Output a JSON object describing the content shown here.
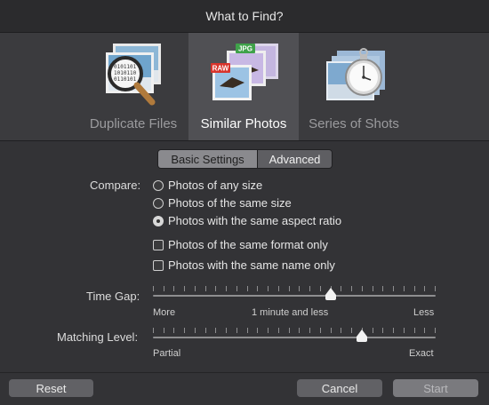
{
  "window": {
    "title": "What to Find?"
  },
  "modes": [
    {
      "label": "Duplicate Files",
      "active": false
    },
    {
      "label": "Similar Photos",
      "active": true
    },
    {
      "label": "Series of Shots",
      "active": false
    }
  ],
  "badges": {
    "jpg": "JPG",
    "raw": "RAW"
  },
  "settings_tabs": [
    {
      "label": "Basic Settings",
      "selected": false
    },
    {
      "label": "Advanced",
      "selected": true
    }
  ],
  "compare": {
    "label": "Compare:",
    "options": [
      {
        "label": "Photos of any size",
        "selected": false
      },
      {
        "label": "Photos of the same size",
        "selected": false
      },
      {
        "label": "Photos with the same aspect ratio",
        "selected": true
      }
    ]
  },
  "checkboxes": [
    {
      "label": "Photos of the same format only",
      "checked": false
    },
    {
      "label": "Photos with the same name only",
      "checked": false
    }
  ],
  "time_gap": {
    "label": "Time Gap:",
    "min_label": "More",
    "mid_label": "1 minute and less",
    "max_label": "Less",
    "value": 0.63
  },
  "matching_level": {
    "label": "Matching Level:",
    "min_label": "Partial",
    "max_label": "Exact",
    "value": 0.74
  },
  "buttons": {
    "reset": "Reset",
    "cancel": "Cancel",
    "start": "Start"
  }
}
